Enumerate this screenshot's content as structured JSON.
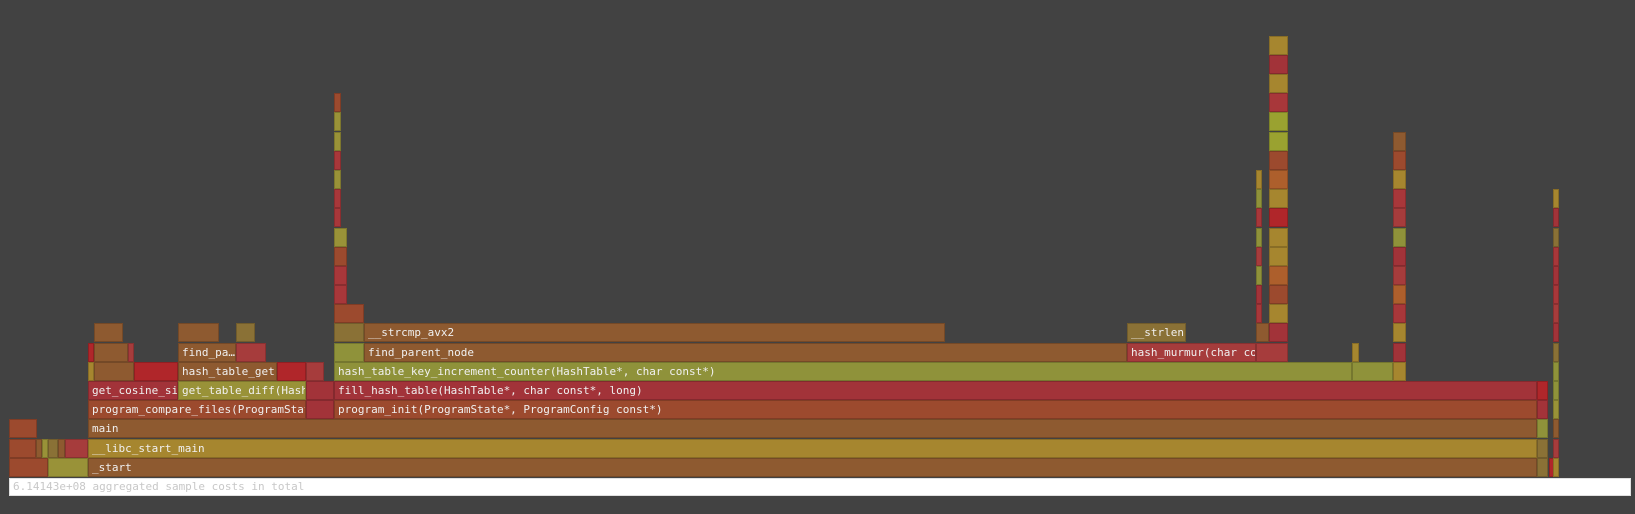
{
  "frames": {
    "start": "_start",
    "libc_start_main": "__libc_start_main",
    "main": "main",
    "program_compare_files": "program_compare_files(ProgramStat",
    "program_init": "program_init(ProgramState*, ProgramConfig const*)",
    "get_cosine_si": "get_cosine_si",
    "get_table_diff": "get_table_diff(Hash",
    "fill_hash_table": "fill_hash_table(HashTable*, char const*, long)",
    "hash_table_get": "hash_table_get",
    "hash_table_key_increment_counter": "hash_table_key_increment_counter(HashTable*, char const*)",
    "find_pa": "find_pa…",
    "find_parent_node": "find_parent_node",
    "hash_murmur": "hash_murmur(char co",
    "strcmp_avx2": "__strcmp_avx2",
    "strlen": "__strlen"
  },
  "status": {
    "total": "6.14143e+08 aggregated sample costs in total"
  }
}
